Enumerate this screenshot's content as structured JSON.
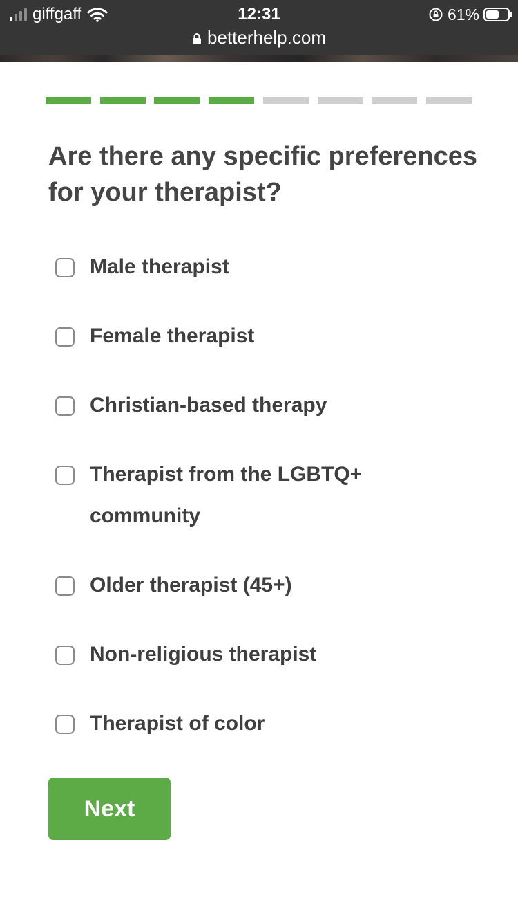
{
  "status_bar": {
    "carrier": "giffgaff",
    "time": "12:31",
    "battery_percent": "61%",
    "battery_level": 0.61,
    "signal_bars_on": 1,
    "signal_bars_total": 4,
    "icons": [
      "signal-icon",
      "wifi-icon",
      "orientation-lock-icon",
      "battery-icon",
      "lock-icon"
    ]
  },
  "browser": {
    "url": "betterhelp.com"
  },
  "progress": {
    "completed_steps": 4,
    "total_steps": 8
  },
  "colors": {
    "accent": "#5dab47",
    "inactive_step": "#cfcfcf",
    "status_bar": "#363636"
  },
  "question": {
    "title": "Are there any specific preferences for your therapist?"
  },
  "options": [
    {
      "label": "Male therapist",
      "checked": false
    },
    {
      "label": "Female therapist",
      "checked": false
    },
    {
      "label": "Christian-based therapy",
      "checked": false
    },
    {
      "label": "Therapist from the LGBTQ+ community",
      "checked": false
    },
    {
      "label": "Older therapist (45+)",
      "checked": false
    },
    {
      "label": "Non-religious therapist",
      "checked": false
    },
    {
      "label": "Therapist of color",
      "checked": false
    }
  ],
  "actions": {
    "next_label": "Next"
  }
}
